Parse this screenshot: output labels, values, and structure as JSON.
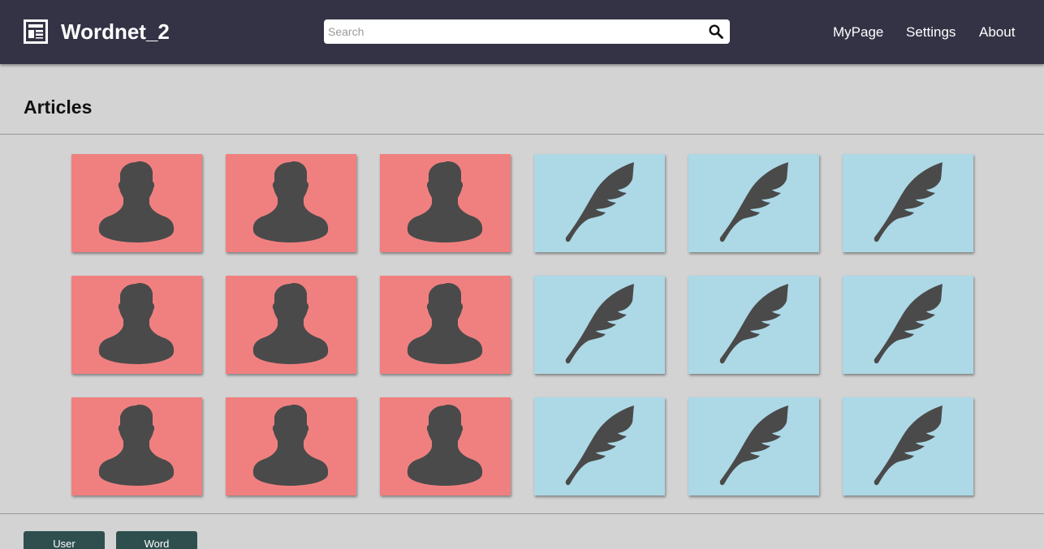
{
  "header": {
    "app_title": "Wordnet_2",
    "logo_icon": "newspaper-icon",
    "search": {
      "placeholder": "Search",
      "value": "",
      "icon": "search-icon"
    },
    "nav": [
      "MyPage",
      "Settings",
      "About"
    ]
  },
  "main": {
    "title": "Articles",
    "tiles": [
      {
        "kind": "user",
        "icon": "user-silhouette-icon",
        "color": "#f08080"
      },
      {
        "kind": "user",
        "icon": "user-silhouette-icon",
        "color": "#f08080"
      },
      {
        "kind": "user",
        "icon": "user-silhouette-icon",
        "color": "#f08080"
      },
      {
        "kind": "word",
        "icon": "quill-feather-icon",
        "color": "#add8e6"
      },
      {
        "kind": "word",
        "icon": "quill-feather-icon",
        "color": "#add8e6"
      },
      {
        "kind": "word",
        "icon": "quill-feather-icon",
        "color": "#add8e6"
      },
      {
        "kind": "user",
        "icon": "user-silhouette-icon",
        "color": "#f08080"
      },
      {
        "kind": "user",
        "icon": "user-silhouette-icon",
        "color": "#f08080"
      },
      {
        "kind": "user",
        "icon": "user-silhouette-icon",
        "color": "#f08080"
      },
      {
        "kind": "word",
        "icon": "quill-feather-icon",
        "color": "#add8e6"
      },
      {
        "kind": "word",
        "icon": "quill-feather-icon",
        "color": "#add8e6"
      },
      {
        "kind": "word",
        "icon": "quill-feather-icon",
        "color": "#add8e6"
      },
      {
        "kind": "user",
        "icon": "user-silhouette-icon",
        "color": "#f08080"
      },
      {
        "kind": "user",
        "icon": "user-silhouette-icon",
        "color": "#f08080"
      },
      {
        "kind": "user",
        "icon": "user-silhouette-icon",
        "color": "#f08080"
      },
      {
        "kind": "word",
        "icon": "quill-feather-icon",
        "color": "#add8e6"
      },
      {
        "kind": "word",
        "icon": "quill-feather-icon",
        "color": "#add8e6"
      },
      {
        "kind": "word",
        "icon": "quill-feather-icon",
        "color": "#add8e6"
      }
    ]
  },
  "footer": {
    "buttons": [
      "User",
      "Word"
    ]
  },
  "colors": {
    "header_bg": "#343346",
    "page_bg": "#d3d3d3",
    "user_tile": "#f08080",
    "word_tile": "#add8e6",
    "icon": "#4a4a4a",
    "footer_button": "#2f4f4f"
  }
}
